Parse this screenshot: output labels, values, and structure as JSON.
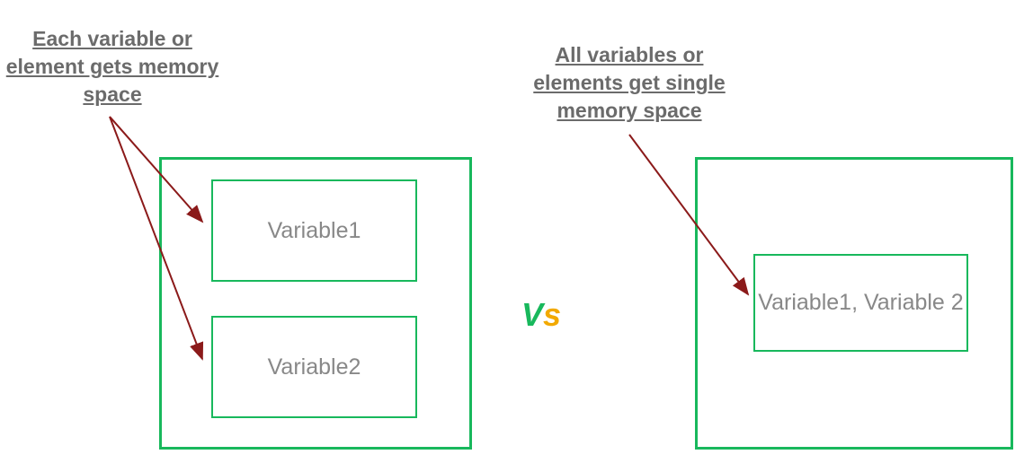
{
  "left": {
    "label": "Each variable or element gets memory space",
    "box1": "Variable1",
    "box2": "Variable2"
  },
  "right": {
    "label": "All variables or elements get single memory  space",
    "box": "Variable1, Variable 2"
  },
  "vs": {
    "v": "V",
    "s": "s"
  }
}
